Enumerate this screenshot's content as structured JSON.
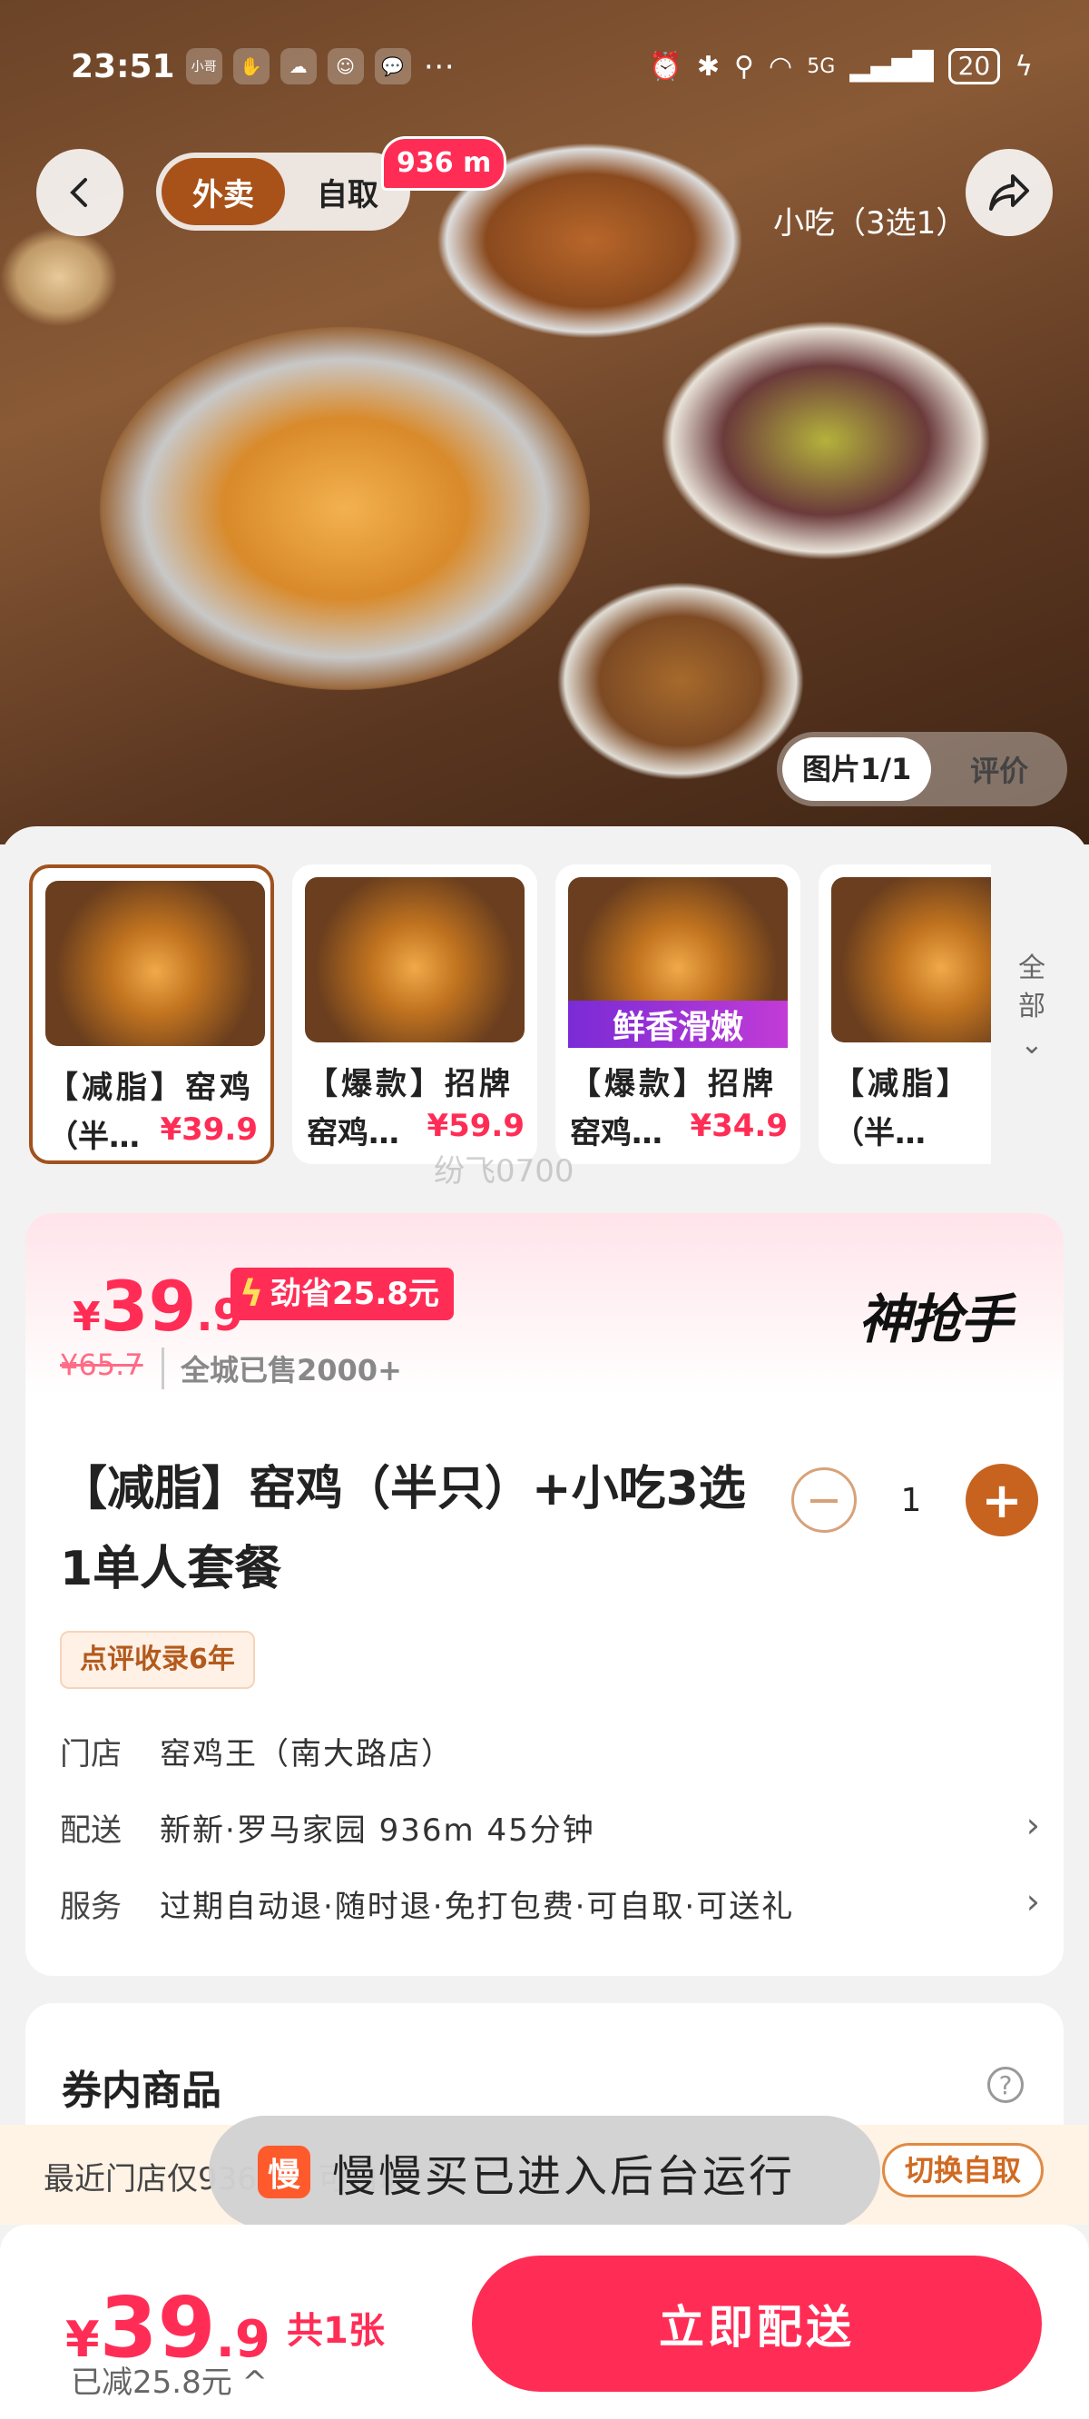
{
  "status_bar": {
    "time": "23:51",
    "app_icons": [
      "小哥",
      "✋",
      "☁",
      "☺",
      "💬",
      "⋯"
    ],
    "network": "5G",
    "battery": "20"
  },
  "header": {
    "tab_delivery": "外卖",
    "tab_pickup": "自取",
    "distance": "936 m",
    "image_caption": "小吃（3选1）",
    "picture_counter": "图片1/1",
    "review_label": "评价"
  },
  "thumbnails": [
    {
      "line1": "【减脂】窑鸡",
      "line2": "（半…",
      "price": "¥39.9",
      "overlay": ""
    },
    {
      "line1": "【爆款】招牌",
      "line2": "窑鸡…",
      "price": "¥59.9",
      "overlay": ""
    },
    {
      "line1": "【爆款】招牌",
      "line2": "窑鸡…",
      "price": "¥34.9",
      "overlay": "鲜香滑嫩"
    },
    {
      "line1": "【减脂】",
      "line2": "（半…",
      "price": "¥",
      "overlay": ""
    }
  ],
  "all_label": [
    "全",
    "部",
    "⌄"
  ],
  "watermark": "纷飞0700",
  "product": {
    "price_symbol": "¥",
    "price_int": "39",
    "price_dec": ".9",
    "save_tag": "劲省25.8元",
    "brand": "神抢手",
    "original_price": "¥65.7",
    "sold": "全城已售2000+",
    "title": "【减脂】窑鸡（半只）+小吃3选1单人套餐",
    "quantity": "1",
    "review_tag": "点评收录6年",
    "store_label": "门店",
    "store_value": "窑鸡王（南大路店）",
    "delivery_label": "配送",
    "delivery_value": "新新·罗马家园  936m  45分钟",
    "service_label": "服务",
    "service_value": "过期自动退·随时退·免打包费·可自取·可送礼"
  },
  "goods": {
    "title": "券内商品",
    "help": "?"
  },
  "notice": {
    "text": "最近门店仅936m，可自取",
    "switch": "切换自取"
  },
  "toast": {
    "icon": "慢",
    "text": "慢慢买已进入后台运行"
  },
  "bottom_bar": {
    "price_symbol": "¥",
    "price_int": "39",
    "price_dec": ".9",
    "count": "共1张",
    "saved": "已减25.8元 ^",
    "cta": "立即配送"
  },
  "colors": {
    "accent": "#ff2d55",
    "brown": "#a8521a"
  }
}
